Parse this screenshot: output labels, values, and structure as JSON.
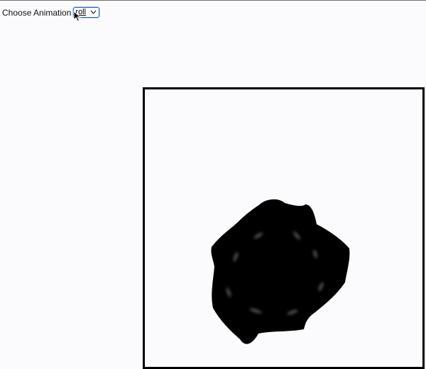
{
  "controls": {
    "label": "Choose Animation",
    "select": {
      "selected": "roll"
    }
  },
  "icons": {
    "dropdown": "chevron-down-icon",
    "pointer": "mouse-cursor-icon"
  },
  "colors": {
    "shape_fill": "#000000",
    "stage_border": "#000000",
    "select_border": "#2b59c3",
    "page_background": "#fbfbfd"
  }
}
